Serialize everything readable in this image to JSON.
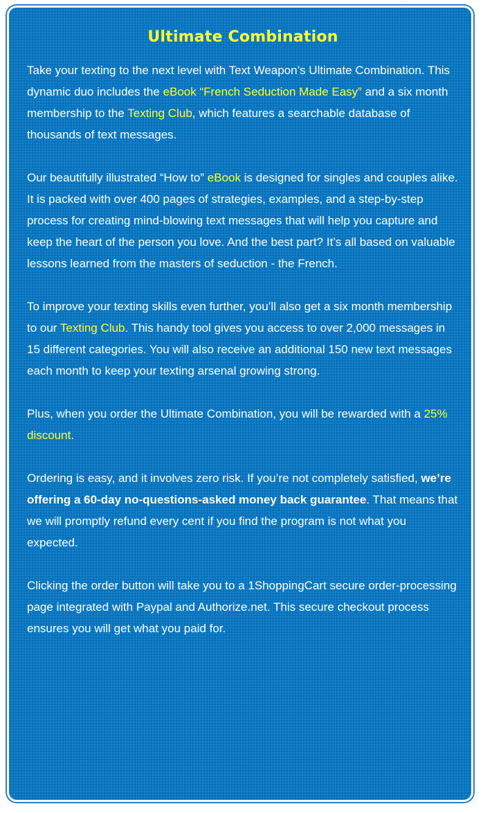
{
  "title": "Ultimate Combination",
  "p1": {
    "a": "Take your texting to the next level with Text Weapon’s Ultimate Combination. This dynamic duo includes the ",
    "link1": "eBook “French Seduction Made Easy”",
    "b": " and a six month membership to the ",
    "link2": "Texting Club",
    "c": ", which features a searchable database of thousands of text messages."
  },
  "p2": {
    "a": "Our beautifully illustrated “How to” ",
    "link": "eBook",
    "b": " is designed for singles and couples alike. It is packed with over 400 pages of strategies, examples, and a step-by-step process for creating mind-blowing text messages that will help you capture and keep the heart of the person you love. And the best part? It’s all based on valuable lessons learned from the masters of seduction - the French."
  },
  "p3": {
    "a": "To improve your texting skills even further, you’ll also get a six month membership to our ",
    "link": "Texting Club",
    "b": ". This handy tool gives you access to over 2,000 messages in 15 different categories. You will also receive an additional 150 new text messages each month to keep your texting arsenal growing strong."
  },
  "p4": {
    "a": "Plus, when you order the Ultimate Combination, you will be rewarded with a ",
    "link": "25% discount",
    "b": "."
  },
  "p5": {
    "a": "Ordering is easy, and it involves zero risk. If you’re not completely satisfied, ",
    "bold": "we’re offering a 60-day no-questions-asked money back guarantee",
    "b": ". That means that we will promptly refund every cent if you find the program is not what you expected."
  },
  "p6": {
    "text": "Clicking the order button will take you to a 1ShoppingCart secure order-processing page integrated with Paypal and Authorize.net. This secure checkout process ensures you will get what you paid for."
  },
  "colors": {
    "panel_background": "#0a79c4",
    "title": "#ffff33",
    "highlight": "#ffff33",
    "body_text": "#ffffff"
  }
}
